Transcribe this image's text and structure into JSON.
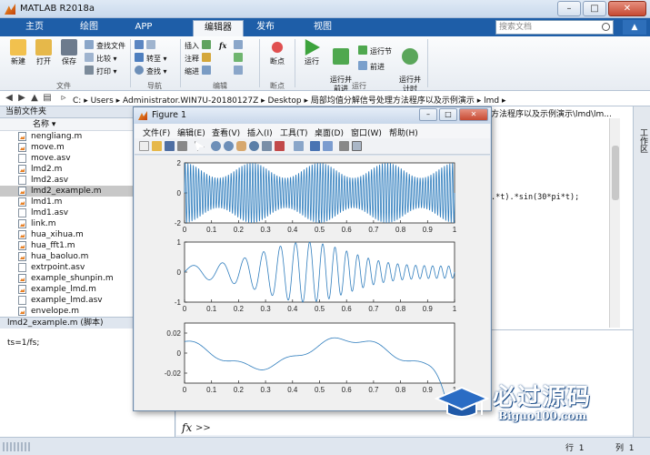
{
  "app": {
    "title": "MATLAB R2018a"
  },
  "window_buttons": {
    "minimize": "–",
    "maximize": "□",
    "close": "✕"
  },
  "tabs": [
    {
      "label": "主页"
    },
    {
      "label": "绘图"
    },
    {
      "label": "APP"
    },
    {
      "label": "编辑器"
    },
    {
      "label": "发布"
    },
    {
      "label": "视图"
    }
  ],
  "search": {
    "placeholder": "搜索文档"
  },
  "ribbon": {
    "file_group": {
      "label": "文件",
      "new": "新建",
      "open": "打开",
      "save": "保存",
      "find_files": "查找文件",
      "compare": "比较",
      "print": "打印"
    },
    "nav_group": {
      "label": "导航",
      "goto": "转至",
      "find": "查找"
    },
    "edit_group": {
      "label": "编辑",
      "insert": "插入",
      "comment": "注释",
      "indent": "缩进",
      "fx": "fx"
    },
    "breakpoint_group": {
      "label": "断点",
      "breakpoints": "断点"
    },
    "run_group": {
      "label": "运行",
      "run": "运行",
      "run_advance": "运行并\n前进",
      "run_section": "运行节",
      "advance": "前进",
      "run_time": "运行并\n计时"
    }
  },
  "path": {
    "segments": [
      "C:",
      "Users",
      "Administrator.WIN7U-20180127Z",
      "Desktop",
      "局部均值分解信号处理方法程序以及示例演示",
      "lmd"
    ]
  },
  "current_folder": {
    "header": "当前文件夹",
    "column_name": "名称",
    "files": [
      {
        "name": "nengliang.m",
        "type": "m"
      },
      {
        "name": "move.m",
        "type": "m"
      },
      {
        "name": "move.asv",
        "type": "asv"
      },
      {
        "name": "lmd2.m",
        "type": "m"
      },
      {
        "name": "lmd2.asv",
        "type": "asv"
      },
      {
        "name": "lmd2_example.m",
        "type": "m",
        "selected": true
      },
      {
        "name": "lmd1.m",
        "type": "m"
      },
      {
        "name": "lmd1.asv",
        "type": "asv"
      },
      {
        "name": "link.m",
        "type": "m"
      },
      {
        "name": "hua_xihua.m",
        "type": "m"
      },
      {
        "name": "hua_fft1.m",
        "type": "m"
      },
      {
        "name": "hua_baoluo.m",
        "type": "m"
      },
      {
        "name": "extrpoint.asv",
        "type": "asv"
      },
      {
        "name": "example_shunpin.m",
        "type": "m"
      },
      {
        "name": "example_lmd.m",
        "type": "m"
      },
      {
        "name": "example_lmd.asv",
        "type": "asv"
      },
      {
        "name": "envelope.m",
        "type": "m"
      }
    ],
    "details_title": "lmd2_example.m  (脚本)",
    "details_code": "ts=1/fs;"
  },
  "editor": {
    "path_tail": "方法程序以及示例演示\\lmd\\lm...",
    "code_line": ".*t).*sin(30*pi*t);"
  },
  "right_strip": {
    "label": "工作区"
  },
  "command_window": {
    "fx": "fx",
    "prompt": ">>"
  },
  "status": {
    "row_label": "行",
    "row_value": "1",
    "col_label": "列",
    "col_value": "1"
  },
  "figure": {
    "title": "Figure 1",
    "menu": [
      "文件(F)",
      "编辑(E)",
      "查看(V)",
      "插入(I)",
      "工具(T)",
      "桌面(D)",
      "窗口(W)",
      "帮助(H)"
    ],
    "line_color": "#2f7dbd"
  },
  "chart_data": [
    {
      "type": "line",
      "x_ticks": [
        "0",
        "0.1",
        "0.2",
        "0.3",
        "0.4",
        "0.5",
        "0.6",
        "0.7",
        "0.8",
        "0.9",
        "1"
      ],
      "y_ticks": [
        "2",
        "0",
        "-2"
      ],
      "xlim": [
        0,
        1
      ],
      "ylim": [
        -2,
        2
      ],
      "series": [
        {
          "shape": "carrier 100 Hz, amplitude modulated by 1.5+0.5cos(2π·4t)"
        }
      ]
    },
    {
      "type": "line",
      "x_ticks": [
        "0",
        "0.1",
        "0.2",
        "0.3",
        "0.4",
        "0.5",
        "0.6",
        "0.7",
        "0.8",
        "0.9",
        "1"
      ],
      "y_ticks": [
        "1",
        "0",
        "-1"
      ],
      "xlim": [
        0,
        1
      ],
      "ylim": [
        -1,
        1
      ],
      "series": [
        {
          "shape": "chirp-like oscillation, amplitude ~0.2→1→0.2"
        }
      ]
    },
    {
      "type": "line",
      "x_ticks": [
        "0",
        "0.1",
        "0.2",
        "0.3",
        "0.4",
        "0.5",
        "0.6",
        "0.7",
        "0.8",
        "0.9",
        "1"
      ],
      "y_ticks": [
        "0.02",
        "0",
        "-0.02"
      ],
      "xlim": [
        0,
        1
      ],
      "ylim": [
        -0.03,
        0.03
      ],
      "series": [
        {
          "shape": "slow residual, ~0.015 with end effect dropping below -0.03 at t≈0.98"
        }
      ]
    }
  ],
  "watermark": {
    "title": "必过源码",
    "sub": "Biguo100.com"
  }
}
